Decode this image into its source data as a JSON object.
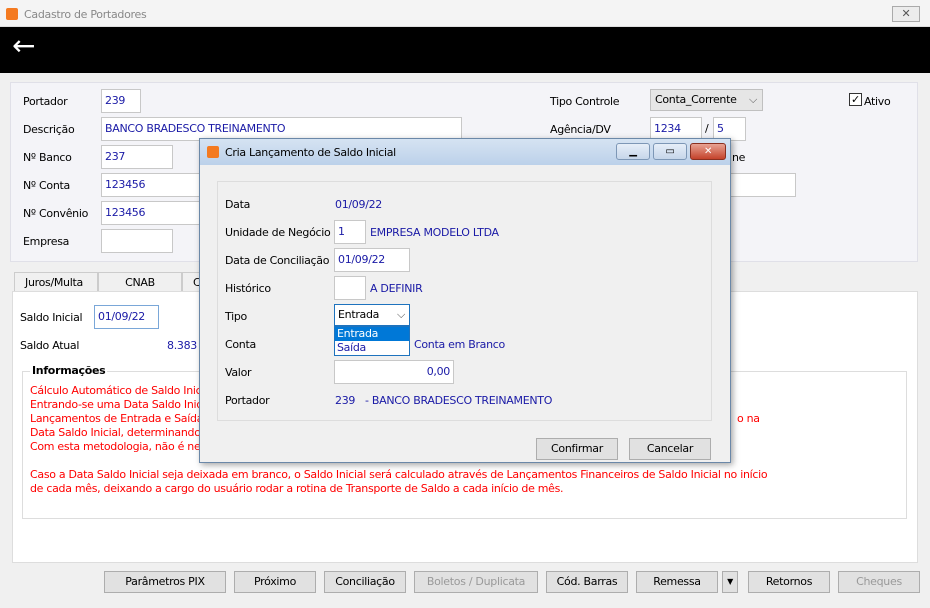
{
  "window": {
    "title": "Cadastro de Portadores",
    "close": "✕",
    "back": "←"
  },
  "form": {
    "portador_label": "Portador",
    "portador": "239",
    "descricao_label": "Descrição",
    "descricao": "BANCO BRADESCO TREINAMENTO",
    "nbanco_label": "Nº Banco",
    "nbanco": "237",
    "nconta_label": "Nº Conta",
    "nconta": "123456",
    "nconvenio_label": "Nº Convênio",
    "nconvenio": "123456",
    "empresa_label": "Empresa",
    "tipo_controle_label": "Tipo Controle",
    "tipo_controle": "Conta_Corrente",
    "agencia_label": "Agência/DV",
    "agencia": "1234",
    "dv": "5",
    "sep": "/",
    "ativo_label": "Ativo",
    "ativo": true,
    "partial_label": "ne"
  },
  "tabs": [
    "Juros/Multa",
    "CNAB",
    "Co"
  ],
  "saldo": {
    "inicial_label": "Saldo Inicial",
    "inicial": "01/09/22",
    "atual_label": "Saldo Atual",
    "atual": "8.383"
  },
  "info": {
    "title": "Informações",
    "lines": [
      "Cálculo Automático de Saldo Inici",
      "Entrando-se uma Data Saldo Inic",
      "Lançamentos de Entrada e Saída",
      "Data Saldo Inicial, determinando",
      "Com esta metodologia, não é nec"
    ],
    "line3_end": "o na",
    "para2": [
      "Caso a Data Saldo Inicial seja deixada em branco, o Saldo Inicial será calculado através de Lançamentos Financeiros de Saldo Inicial no início",
      "de cada mês, deixando a cargo do usuário rodar a rotina de Transporte de Saldo a cada início de mês."
    ]
  },
  "buttons": [
    "Parâmetros PIX",
    "Próximo",
    "Conciliação",
    "Boletos / Duplicata",
    "Cód. Barras",
    "Remessa",
    "▼",
    "Retornos",
    "Cheques"
  ],
  "dialog": {
    "title": "Cria Lançamento de Saldo Inicial",
    "data_label": "Data",
    "data": "01/09/22",
    "unidade_label": "Unidade de Negócio",
    "unidade": "1",
    "unidade_nome": "EMPRESA MODELO LTDA",
    "conciliacao_label": "Data de Conciliação",
    "conciliacao": "01/09/22",
    "historico_label": "Histórico",
    "historico_nome": "A DEFINIR",
    "tipo_label": "Tipo",
    "tipo": "Entrada",
    "tipo_options": [
      "Entrada",
      "Saída"
    ],
    "conta_label": "Conta",
    "conta_nome": "Conta em Branco",
    "valor_label": "Valor",
    "valor": "0,00",
    "portador_label": "Portador",
    "portador": "239",
    "portador_nome": "- BANCO BRADESCO TREINAMENTO",
    "confirmar": "Confirmar",
    "cancelar": "Cancelar"
  }
}
